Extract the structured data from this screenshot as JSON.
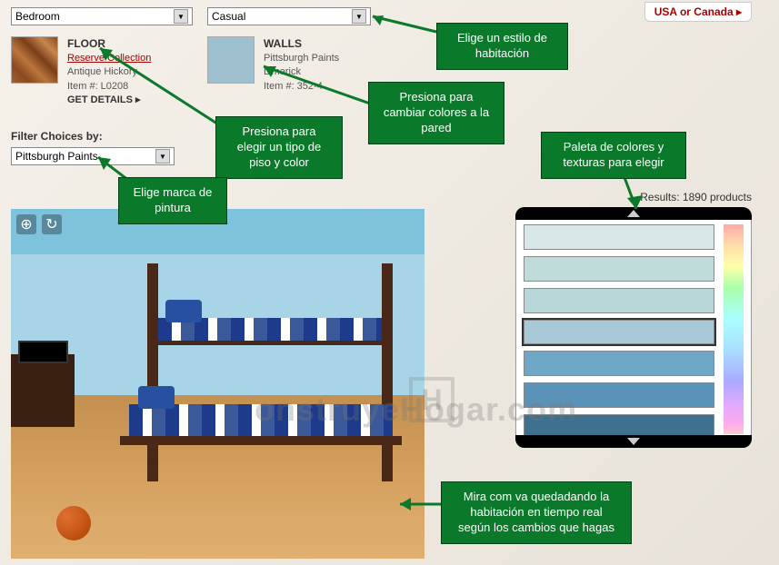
{
  "top_link": "USA or Canada ▸",
  "dropdowns": {
    "room": "Bedroom",
    "style": "Casual",
    "brand": "Pittsburgh Paints"
  },
  "floor_card": {
    "title": "FLOOR",
    "link": "Reserve Collection",
    "name": "Antique Hickory",
    "item": "Item #: L0208",
    "cta": "GET DETAILS  ▸"
  },
  "walls_card": {
    "title": "WALLS",
    "brand": "Pittsburgh Paints",
    "name": "Limerick",
    "item": "Item #: 352-4"
  },
  "filter_label": "Filter Choices by:",
  "results": "Results: 1890 products",
  "palette_colors": [
    "#d8e8e8",
    "#c0dcda",
    "#b8d6d8",
    "#a8cad8",
    "#6fa8c6",
    "#5a92b8",
    "#3e7090"
  ],
  "palette_selected_index": 3,
  "annotations": {
    "style": "Elige un estilo de habitación",
    "walls": "Presiona para cambiar colores a la pared",
    "floor": "Presiona para elegir un tipo de piso y color",
    "brand": "Elige marca de pintura",
    "palette": "Paleta de colores y texturas para elegir",
    "viewer": "Mira com va quedadando la habitación en tiempo real según los cambios que hagas"
  },
  "watermark": "onstruyeHogar.com"
}
